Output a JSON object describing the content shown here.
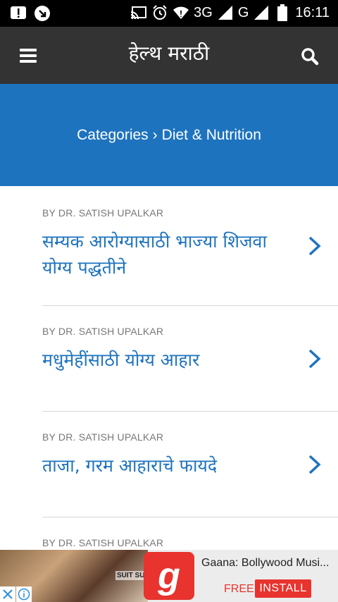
{
  "status_bar": {
    "network_3g": "3G",
    "network_g": "G",
    "time": "16:11"
  },
  "app_bar": {
    "title": "हेल्थ मराठी",
    "menu_icon": "hamburger-menu-icon",
    "search_icon": "search-icon"
  },
  "banner": {
    "breadcrumb_root": "Categories",
    "separator": "›",
    "breadcrumb_current": "Diet & Nutrition",
    "background": "#1e73be"
  },
  "articles": [
    {
      "byline": "BY DR. SATISH UPALKAR",
      "title": "सम्यक आरोग्यासाठी भाज्या शिजवा योग्य पद्धतीने"
    },
    {
      "byline": "BY DR. SATISH UPALKAR",
      "title": "मधुमेहींसाठी योग्य आहार"
    },
    {
      "byline": "BY DR. SATISH UPALKAR",
      "title": "ताजा, गरम आहाराचे फायदे"
    },
    {
      "byline": "BY DR. SATISH UPALKAR"
    }
  ],
  "ad": {
    "image_caption": "SUIT SU",
    "logo_letter": "g",
    "title": "Gaana: Bollywood Musi...",
    "free_label": "FREE",
    "install_label": "INSTALL",
    "accent": "#e8332e"
  },
  "colors": {
    "app_bar": "#333333",
    "link": "#1e73be",
    "byline": "#777777"
  }
}
